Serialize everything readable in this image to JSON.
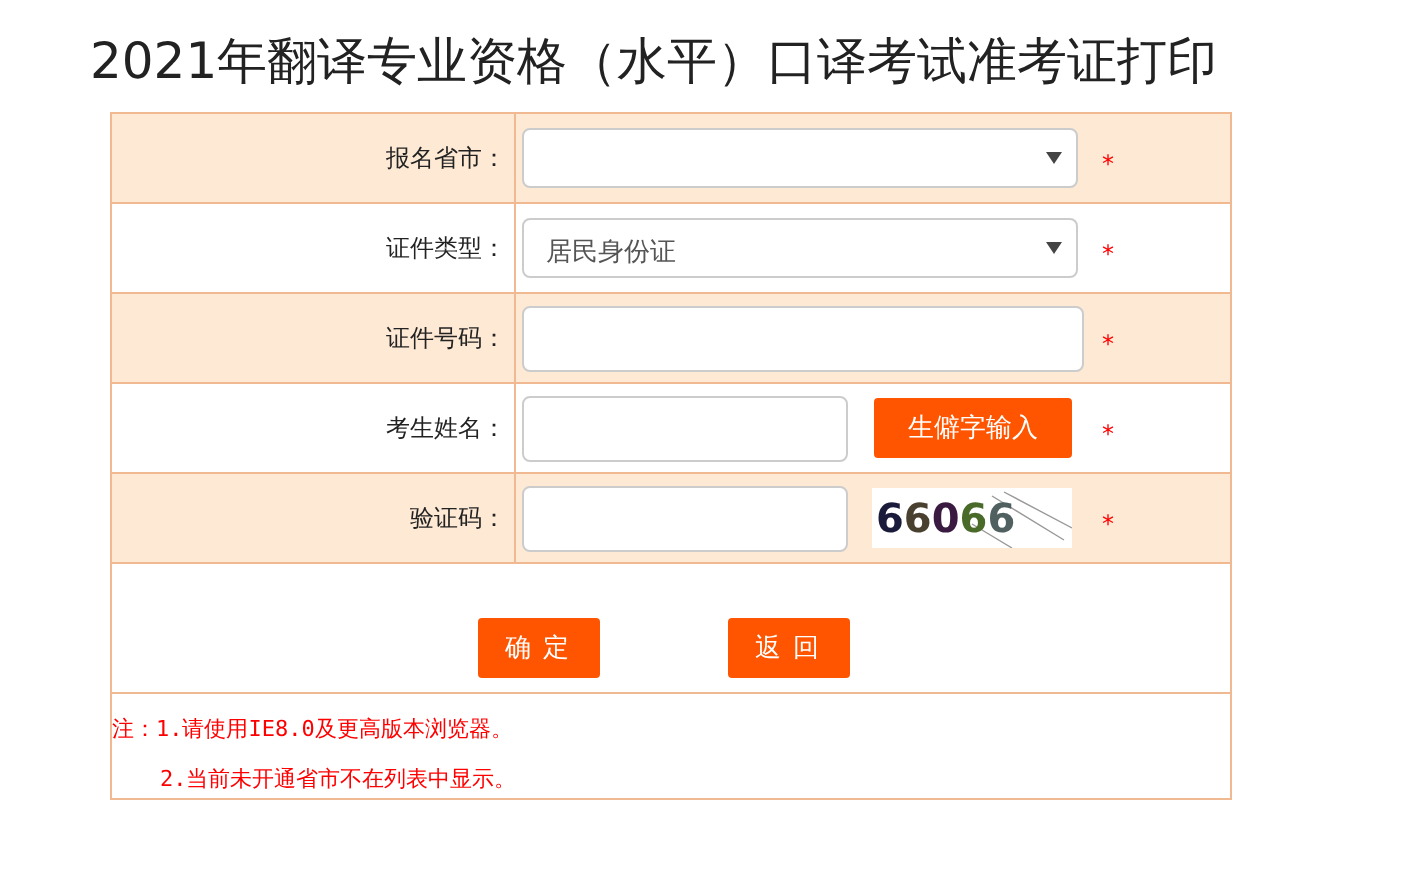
{
  "title": "2021年翻译专业资格（水平）口译考试准考证打印",
  "rows": [
    {
      "label": "报名省市：",
      "kind": "select",
      "value": "",
      "required_mark": "*"
    },
    {
      "label": "证件类型：",
      "kind": "select",
      "value": "居民身份证",
      "required_mark": "*"
    },
    {
      "label": "证件号码：",
      "kind": "input",
      "value": "",
      "required_mark": "*"
    },
    {
      "label": "考生姓名：",
      "kind": "input_button",
      "value": "",
      "button": "生僻字输入",
      "required_mark": "*"
    },
    {
      "label": "验证码：",
      "kind": "captcha",
      "value": "",
      "captcha": "66066",
      "required_mark": "*"
    }
  ],
  "buttons": [
    "确 定",
    "返 回"
  ],
  "notes": [
    "注：1.请使用IE8.0及更高版本浏览器。",
    "2.当前未开通省市不在列表中显示。"
  ]
}
